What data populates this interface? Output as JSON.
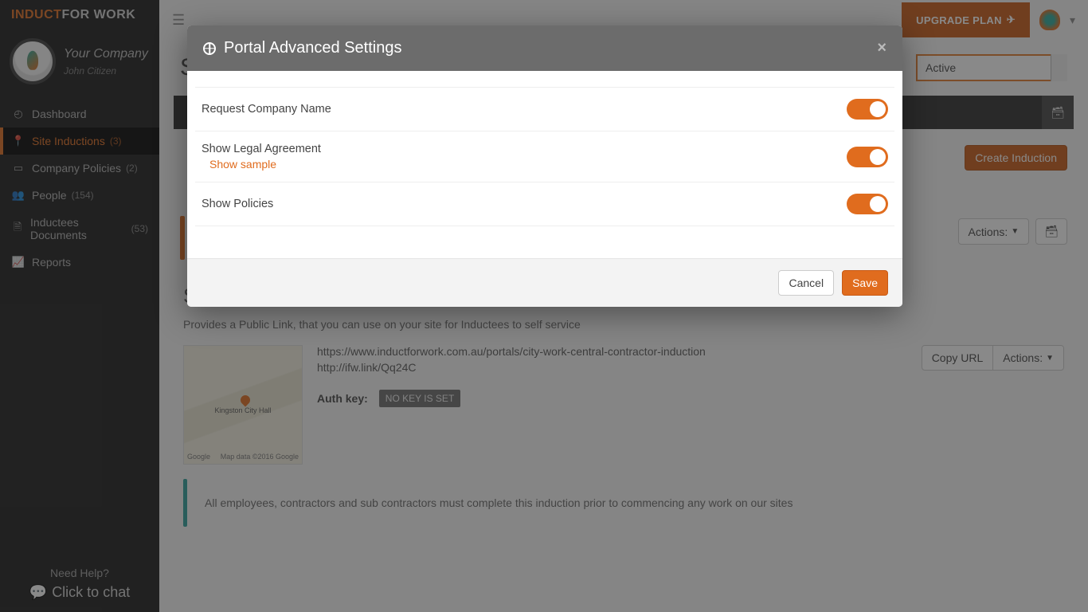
{
  "brand": {
    "part1": "INDUCT",
    "part2": "FOR WORK"
  },
  "company": {
    "name": "Your Company",
    "user": "John Citizen"
  },
  "nav": {
    "dashboard": {
      "label": "Dashboard"
    },
    "site_inductions": {
      "label": "Site Inductions",
      "count": "(3)"
    },
    "company_policies": {
      "label": "Company Policies",
      "count": "(2)"
    },
    "people": {
      "label": "People",
      "count": "(154)"
    },
    "inductees_docs": {
      "label": "Inductees Documents",
      "count": "(53)"
    },
    "reports": {
      "label": "Reports"
    }
  },
  "help": {
    "title": "Need Help?",
    "chat": "Click to chat"
  },
  "topbar": {
    "upgrade": "UPGRADE PLAN"
  },
  "page": {
    "title_initial": "S",
    "status_selected": "Active",
    "create_btn": "Create Induction",
    "actions": "Actions:"
  },
  "portal": {
    "heading": "Self Service Portal:",
    "desc": "Provides a Public Link, that you can use on your site for Inductees to self service",
    "url1": "https://www.inductforwork.com.au/portals/city-work-central-contractor-induction",
    "url2": "http://ifw.link/Qq24C",
    "auth_label": "Auth key:",
    "auth_value": "NO KEY IS SET",
    "copy": "Copy URL",
    "actions": "Actions:",
    "note": "All employees, contractors and sub contractors must complete this induction prior to commencing any work on our sites",
    "map_google": "Google",
    "map_attr": "Map data ©2016 Google",
    "map_place": "Kingston City Hall"
  },
  "modal": {
    "title": "Portal Advanced Settings",
    "rows": {
      "req_company": "Request Company Name",
      "legal": "Show Legal Agreement",
      "legal_sample": "Show sample",
      "policies": "Show Policies"
    },
    "cancel": "Cancel",
    "save": "Save"
  }
}
